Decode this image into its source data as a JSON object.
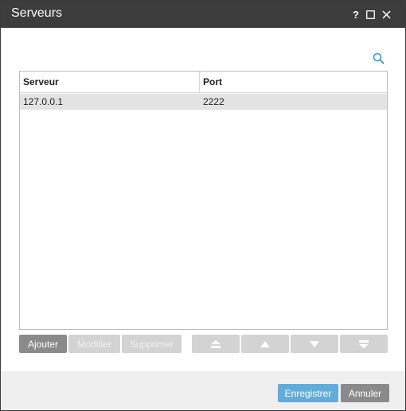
{
  "window": {
    "title": "Serveurs"
  },
  "titlebar": {
    "help_label": "?",
    "icons": {
      "help": "help-icon",
      "maximize": "maximize-icon",
      "close": "close-icon"
    }
  },
  "toolbar": {
    "search_icon": "search-icon"
  },
  "grid": {
    "columns": [
      "Serveur",
      "Port"
    ],
    "rows": [
      {
        "server": "127.0.0.1",
        "port": "2222",
        "selected": true
      }
    ]
  },
  "actions": {
    "add_label": "Ajouter",
    "edit_label": "Modifier",
    "delete_label": "Supprimer",
    "move_icons": [
      "move-to-top-icon",
      "move-up-icon",
      "move-down-icon",
      "move-to-bottom-icon"
    ]
  },
  "footer": {
    "save_label": "Enregistrer",
    "cancel_label": "Annuler"
  },
  "colors": {
    "titlebar": "#3c3c3c",
    "primary_button": "#62acd9",
    "secondary_button": "#8a8a8a",
    "disabled_button": "#d3d3d3",
    "selected_row": "#e3e3e3",
    "accent_icon": "#3a8fd0"
  }
}
